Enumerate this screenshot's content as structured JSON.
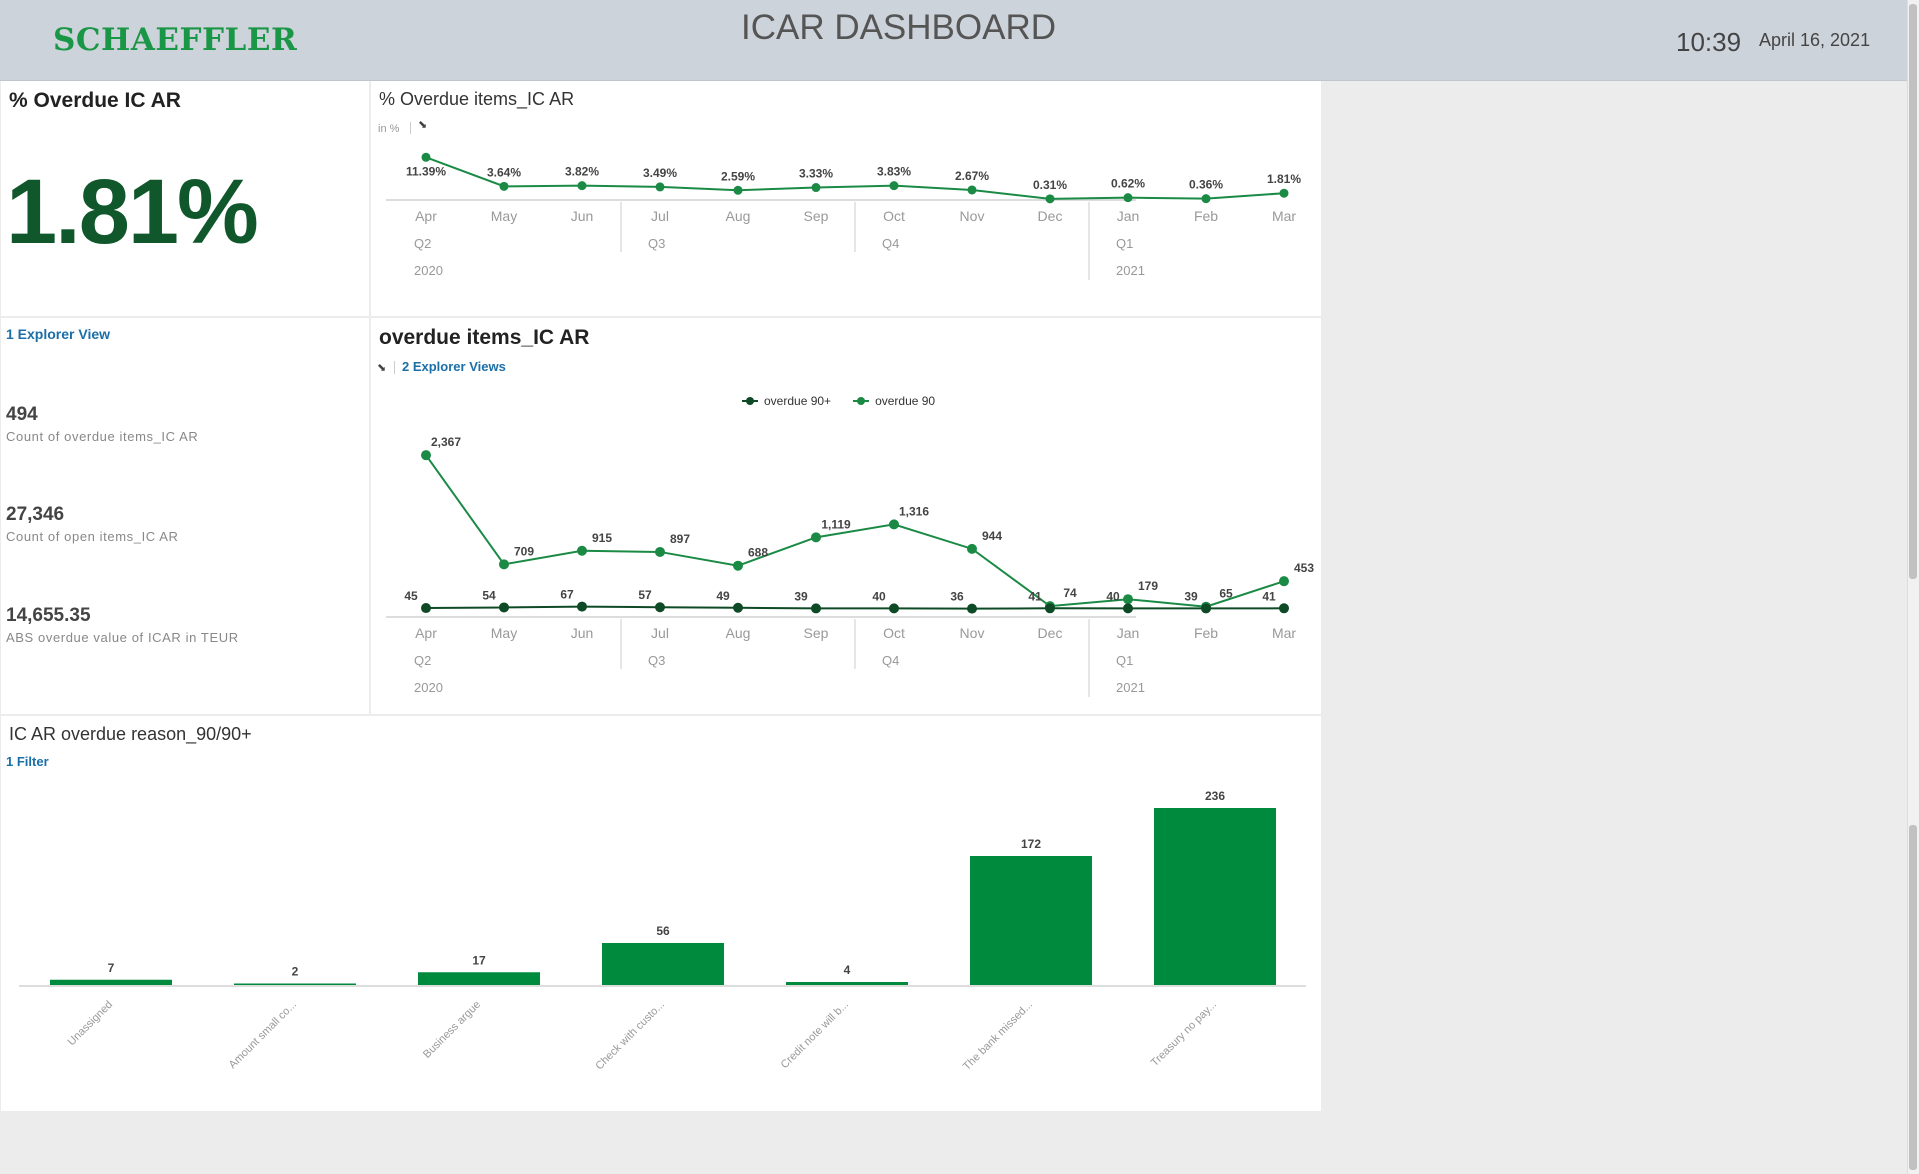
{
  "header": {
    "logo": "SCHAEFFLER",
    "title": "ICAR DASHBOARD",
    "time": "10:39",
    "date": "April 16, 2021"
  },
  "kpi": {
    "title": "% Overdue IC AR",
    "value": "1.81%"
  },
  "stats": {
    "link": "1 Explorer View",
    "items": [
      {
        "value": "494",
        "label": "Count of overdue items_IC AR"
      },
      {
        "value": "27,346",
        "label": "Count of open items_IC AR"
      },
      {
        "value": "14,655.35",
        "label": "ABS overdue value of ICAR in TEUR"
      }
    ]
  },
  "bar_panel": {
    "link": "1 Filter"
  },
  "chart_data": [
    {
      "type": "line",
      "title": "% Overdue items_IC AR",
      "unit_label": "in %",
      "categories": [
        "Apr",
        "May",
        "Jun",
        "Jul",
        "Aug",
        "Sep",
        "Oct",
        "Nov",
        "Dec",
        "Jan",
        "Feb",
        "Mar"
      ],
      "quarters": [
        "Q2",
        "Q3",
        "Q4",
        "Q1"
      ],
      "years": [
        "2020",
        "2021"
      ],
      "series": [
        {
          "values": [
            11.39,
            3.64,
            3.82,
            3.49,
            2.59,
            3.33,
            3.83,
            2.67,
            0.31,
            0.62,
            0.36,
            1.81
          ],
          "labels": [
            "11.39%",
            "3.64%",
            "3.82%",
            "3.49%",
            "2.59%",
            "3.33%",
            "3.83%",
            "2.67%",
            "0.31%",
            "0.62%",
            "0.36%",
            "1.81%"
          ],
          "color": "#1a8a45"
        }
      ],
      "ylim": [
        0,
        12
      ]
    },
    {
      "type": "line",
      "title": "overdue items_IC AR",
      "link": "2 Explorer Views",
      "categories": [
        "Apr",
        "May",
        "Jun",
        "Jul",
        "Aug",
        "Sep",
        "Oct",
        "Nov",
        "Dec",
        "Jan",
        "Feb",
        "Mar"
      ],
      "quarters": [
        "Q2",
        "Q3",
        "Q4",
        "Q1"
      ],
      "years": [
        "2020",
        "2021"
      ],
      "legend_position": "top-center",
      "series": [
        {
          "name": "overdue 90+",
          "values": [
            45,
            54,
            67,
            57,
            49,
            39,
            40,
            36,
            41,
            40,
            39,
            41
          ],
          "labels": [
            "45",
            "54",
            "67",
            "57",
            "49",
            "39",
            "40",
            "36",
            "41",
            "40",
            "39",
            "41"
          ],
          "color": "#0e4a25"
        },
        {
          "name": "overdue 90",
          "values": [
            2367,
            709,
            915,
            897,
            688,
            1119,
            1316,
            944,
            74,
            179,
            65,
            453
          ],
          "labels": [
            "2,367",
            "709",
            "915",
            "897",
            "688",
            "1,119",
            "1,316",
            "944",
            "74",
            "179",
            "65",
            "453"
          ],
          "color": "#1a8a45"
        }
      ],
      "ylim": [
        0,
        2400
      ]
    },
    {
      "type": "bar",
      "title": "IC AR overdue reason_90/90+",
      "categories": [
        "Unassigned",
        "Amount small co...",
        "Business argue",
        "Check with custo...",
        "Credit note will b...",
        "The bank missed...",
        "Treasury no pay..."
      ],
      "values": [
        7,
        2,
        17,
        56,
        4,
        172,
        236
      ],
      "color": "#008a3e",
      "ylim": [
        0,
        236
      ]
    }
  ]
}
